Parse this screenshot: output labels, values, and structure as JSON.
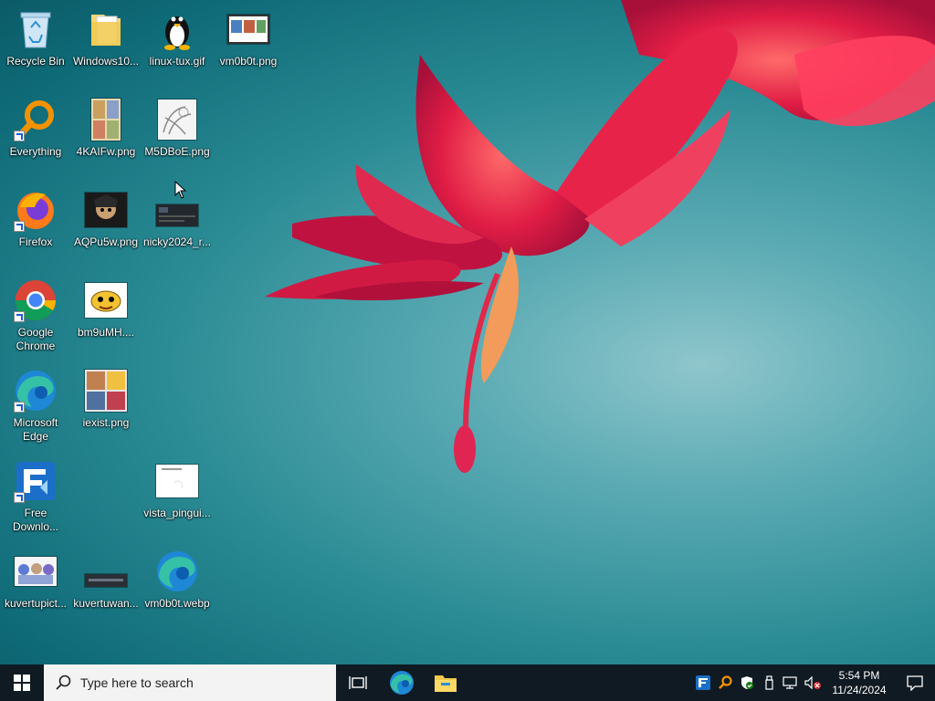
{
  "desktop": {
    "icons": [
      {
        "label": "Recycle Bin"
      },
      {
        "label": "Windows10..."
      },
      {
        "label": "linux-tux.gif"
      },
      {
        "label": "vm0b0t.png"
      },
      {
        "label": "Everything"
      },
      {
        "label": "4KAIFw.png"
      },
      {
        "label": "M5DBoE.png"
      },
      {
        "label": "Firefox"
      },
      {
        "label": "AQPu5w.png"
      },
      {
        "label": "nicky2024_r..."
      },
      {
        "label": "Google Chrome"
      },
      {
        "label": "bm9uMH...."
      },
      {
        "label": "Microsoft Edge"
      },
      {
        "label": "iexist.png"
      },
      {
        "label": "Free Downlo..."
      },
      {
        "label": "vista_pingui..."
      },
      {
        "label": "kuvertupict..."
      },
      {
        "label": "kuvertuwan..."
      },
      {
        "label": "vm0b0t.webp"
      }
    ]
  },
  "taskbar": {
    "search_placeholder": "Type here to search",
    "pinned": [
      "task-view-icon",
      "edge-icon",
      "file-explorer-icon"
    ],
    "tray_icons": [
      "free-download-manager-icon",
      "everything-icon",
      "windows-security-icon",
      "usb-icon",
      "network-icon",
      "volume-muted-icon"
    ],
    "clock_time": "5:54 PM",
    "clock_date": "11/24/2024"
  },
  "colors": {
    "taskbar": "#101a22",
    "desktop_teal": "#2a8b94",
    "flower_red": "#e0284a"
  }
}
